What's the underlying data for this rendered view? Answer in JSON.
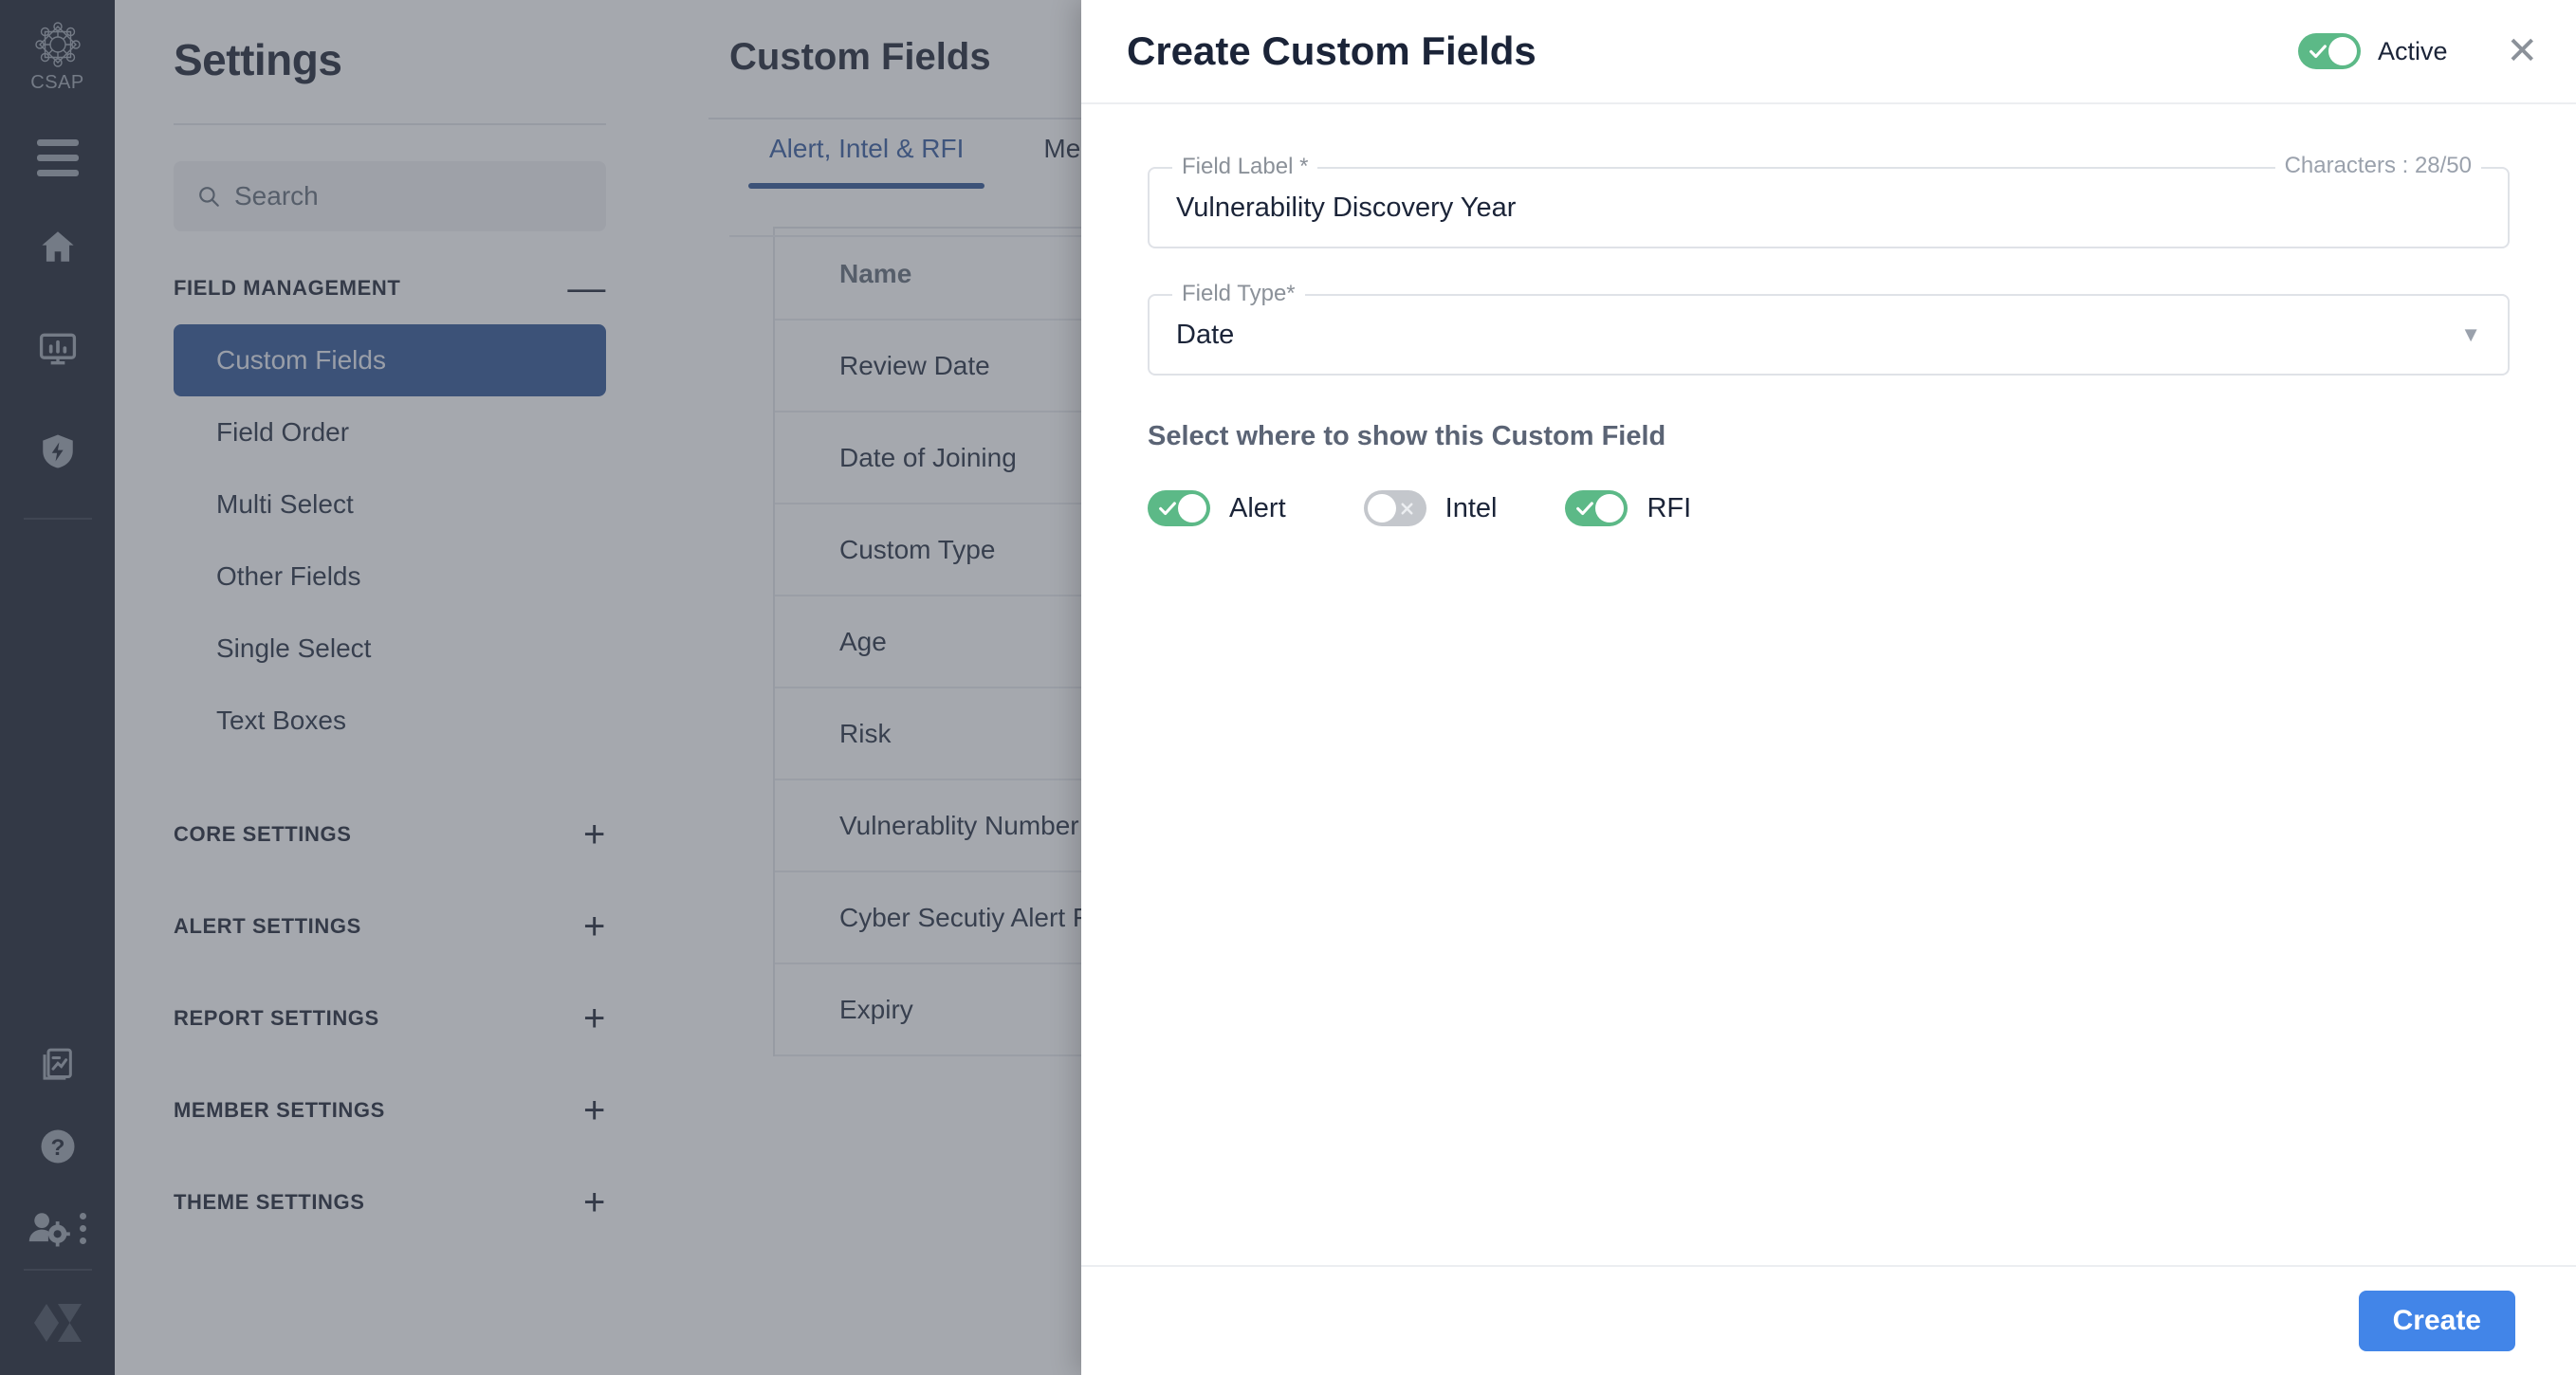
{
  "rail": {
    "logo_text": "CSAP",
    "icons": [
      {
        "name": "hamburger-menu-icon"
      },
      {
        "name": "home-icon"
      },
      {
        "name": "dashboard-monitor-icon"
      },
      {
        "name": "shield-threat-icon"
      },
      {
        "name": "reports-document-icon"
      },
      {
        "name": "help-question-icon"
      },
      {
        "name": "user-settings-icon"
      },
      {
        "name": "app-logo-bottom-icon"
      }
    ]
  },
  "settings": {
    "title": "Settings",
    "search": {
      "placeholder": "Search",
      "value": ""
    },
    "field_management": {
      "header": "FIELD MANAGEMENT",
      "toggle_glyph": "—",
      "items": [
        {
          "label": "Custom Fields",
          "active": true
        },
        {
          "label": "Field Order",
          "active": false
        },
        {
          "label": "Multi Select",
          "active": false
        },
        {
          "label": "Other Fields",
          "active": false
        },
        {
          "label": "Single Select",
          "active": false
        },
        {
          "label": "Text Boxes",
          "active": false
        }
      ]
    },
    "collapsed_sections": [
      {
        "label": "CORE SETTINGS",
        "toggle_glyph": "+"
      },
      {
        "label": "ALERT SETTINGS",
        "toggle_glyph": "+"
      },
      {
        "label": "REPORT SETTINGS",
        "toggle_glyph": "+"
      },
      {
        "label": "MEMBER SETTINGS",
        "toggle_glyph": "+"
      },
      {
        "label": "THEME SETTINGS",
        "toggle_glyph": "+"
      }
    ]
  },
  "custom_fields": {
    "title": "Custom Fields",
    "tabs": [
      {
        "label": "Alert, Intel & RFI",
        "active": true
      },
      {
        "label": "Member",
        "active": false
      }
    ],
    "table": {
      "columns": [
        "Name"
      ],
      "rows": [
        "Review Date",
        "Date of Joining",
        "Custom Type",
        "Age",
        "Risk",
        "Vulnerablity Number",
        "Cyber Secutiy Alert Field",
        "Expiry"
      ]
    }
  },
  "modal": {
    "title": "Create Custom Fields",
    "active_toggle": {
      "label": "Active",
      "on": true
    },
    "close_glyph": "✕",
    "field_label": {
      "legend": "Field Label *",
      "value": "Vulnerability Discovery Year",
      "counter": "Characters : 28/50"
    },
    "field_type": {
      "legend": "Field Type*",
      "value": "Date",
      "caret_glyph": "▼"
    },
    "show_section": {
      "heading": "Select where to show this Custom Field",
      "toggles": [
        {
          "label": "Alert",
          "on": true
        },
        {
          "label": "Intel",
          "on": false
        },
        {
          "label": "RFI",
          "on": true
        }
      ]
    },
    "footer": {
      "create_label": "Create"
    }
  },
  "colors": {
    "rail_bg": "#111827",
    "accent_blue": "#244b8f",
    "primary_button": "#4285e8",
    "toggle_on_green": "#5cb987",
    "toggle_off_gray": "#c4c7cc",
    "tab_active": "#2a5298"
  }
}
